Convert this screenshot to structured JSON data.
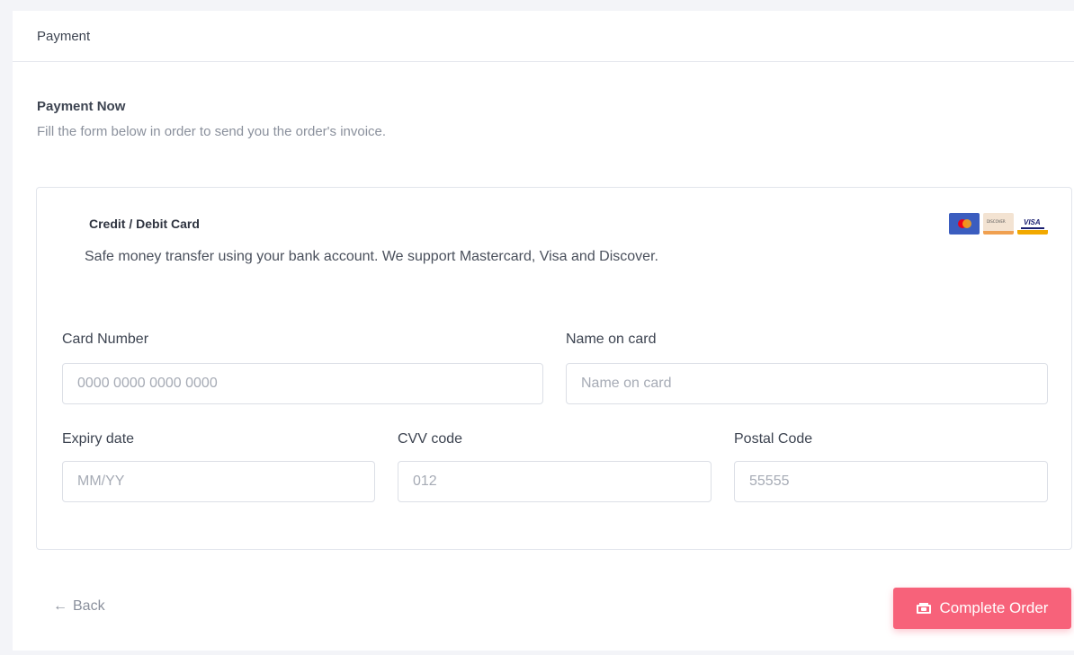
{
  "header": {
    "title": "Payment"
  },
  "intro": {
    "title": "Payment Now",
    "subtitle": "Fill the form below in order to send you the order's invoice."
  },
  "method": {
    "title": "Credit / Debit Card",
    "description": "Safe money transfer using your bank account. We support Mastercard, Visa and Discover.",
    "logos": {
      "discover_text": "DISCOVER",
      "visa_text": "VISA"
    }
  },
  "form": {
    "card_number": {
      "label": "Card Number",
      "placeholder": "0000 0000 0000 0000"
    },
    "name_on_card": {
      "label": "Name on card",
      "placeholder": "Name on card"
    },
    "expiry": {
      "label": "Expiry date",
      "placeholder": "MM/YY"
    },
    "cvv": {
      "label": "CVV code",
      "placeholder": "012"
    },
    "postal": {
      "label": "Postal Code",
      "placeholder": "55555"
    }
  },
  "footer": {
    "back_arrow": "←",
    "back_label": "Back",
    "complete_label": "Complete Order"
  },
  "colors": {
    "accent": "#f7627a",
    "muted_text": "#8a909c",
    "border": "#dcdfe6"
  }
}
